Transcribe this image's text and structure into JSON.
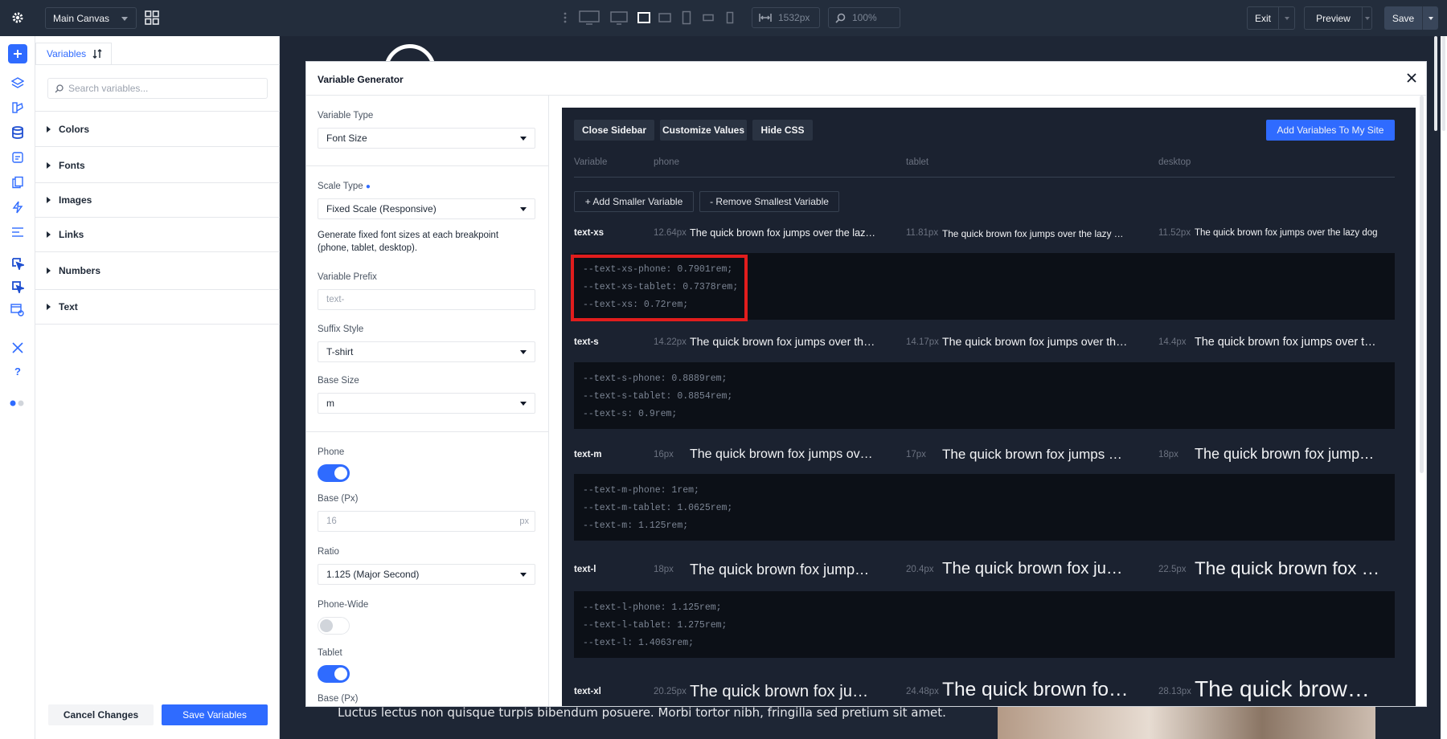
{
  "topbar": {
    "canvas_name": "Main Canvas",
    "width_value": "1532px",
    "zoom_value": "100%",
    "exit_label": "Exit",
    "preview_label": "Preview",
    "save_label": "Save"
  },
  "panel": {
    "tab_label": "Variables",
    "search_placeholder": "Search variables...",
    "items": [
      "Colors",
      "Fonts",
      "Images",
      "Links",
      "Numbers",
      "Text"
    ],
    "cancel_label": "Cancel Changes",
    "save_label": "Save Variables"
  },
  "background": {
    "line1": "Luctus lectus non quisque turpis bibendum posuere. Morbi tortor nibh, fringilla sed pretium sit amet."
  },
  "modal": {
    "title": "Variable Generator",
    "sidebar": {
      "variable_type_label": "Variable Type",
      "variable_type_value": "Font Size",
      "scale_type_label": "Scale Type",
      "scale_type_value": "Fixed Scale (Responsive)",
      "scale_desc": "Generate fixed font sizes at each breakpoint (phone, tablet, desktop).",
      "prefix_label": "Variable Prefix",
      "prefix_placeholder": "text-",
      "suffix_label": "Suffix Style",
      "suffix_value": "T-shirt",
      "base_size_label": "Base Size",
      "base_size_value": "m",
      "phone_label": "Phone",
      "phone_on": true,
      "base_px_label": "Base (Px)",
      "base_px_placeholder": "16",
      "px_unit": "px",
      "ratio_label": "Ratio",
      "ratio_value": "1.125 (Major Second)",
      "phone_wide_label": "Phone-Wide",
      "phone_wide_on": false,
      "tablet_label": "Tablet",
      "tablet_on": true,
      "base_px_label2": "Base (Px)"
    },
    "toolbar": {
      "close_sidebar": "Close Sidebar",
      "customize": "Customize Values",
      "hide_css": "Hide CSS",
      "add_vars": "Add Variables To My Site"
    },
    "columns": {
      "variable": "Variable",
      "phone": "phone",
      "tablet": "tablet",
      "desktop": "desktop"
    },
    "add_smaller": "+ Add Smaller Variable",
    "remove_smallest": "- Remove Smallest Variable",
    "preview_text": "The quick brown fox jumps over the lazy dog",
    "rows": [
      {
        "name": "text-xs",
        "phone_px": "12.64px",
        "tablet_px": "11.81px",
        "desktop_px": "11.52px",
        "css": [
          "--text-xs-phone: 0.7901rem;",
          "--text-xs-tablet: 0.7378rem;",
          "--text-xs: 0.72rem;"
        ]
      },
      {
        "name": "text-s",
        "phone_px": "14.22px",
        "tablet_px": "14.17px",
        "desktop_px": "14.4px",
        "css": [
          "--text-s-phone: 0.8889rem;",
          "--text-s-tablet: 0.8854rem;",
          "--text-s: 0.9rem;"
        ]
      },
      {
        "name": "text-m",
        "phone_px": "16px",
        "tablet_px": "17px",
        "desktop_px": "18px",
        "css": [
          "--text-m-phone: 1rem;",
          "--text-m-tablet: 1.0625rem;",
          "--text-m: 1.125rem;"
        ]
      },
      {
        "name": "text-l",
        "phone_px": "18px",
        "tablet_px": "20.4px",
        "desktop_px": "22.5px",
        "css": [
          "--text-l-phone: 1.125rem;",
          "--text-l-tablet: 1.275rem;",
          "--text-l: 1.4063rem;"
        ]
      },
      {
        "name": "text-xl",
        "phone_px": "20.25px",
        "tablet_px": "24.48px",
        "desktop_px": "28.13px"
      }
    ]
  },
  "colors": {
    "accent": "#2f6bff",
    "highlight": "#e11d1d",
    "topbar": "#232d3c",
    "dark_panel": "#1b2230"
  }
}
